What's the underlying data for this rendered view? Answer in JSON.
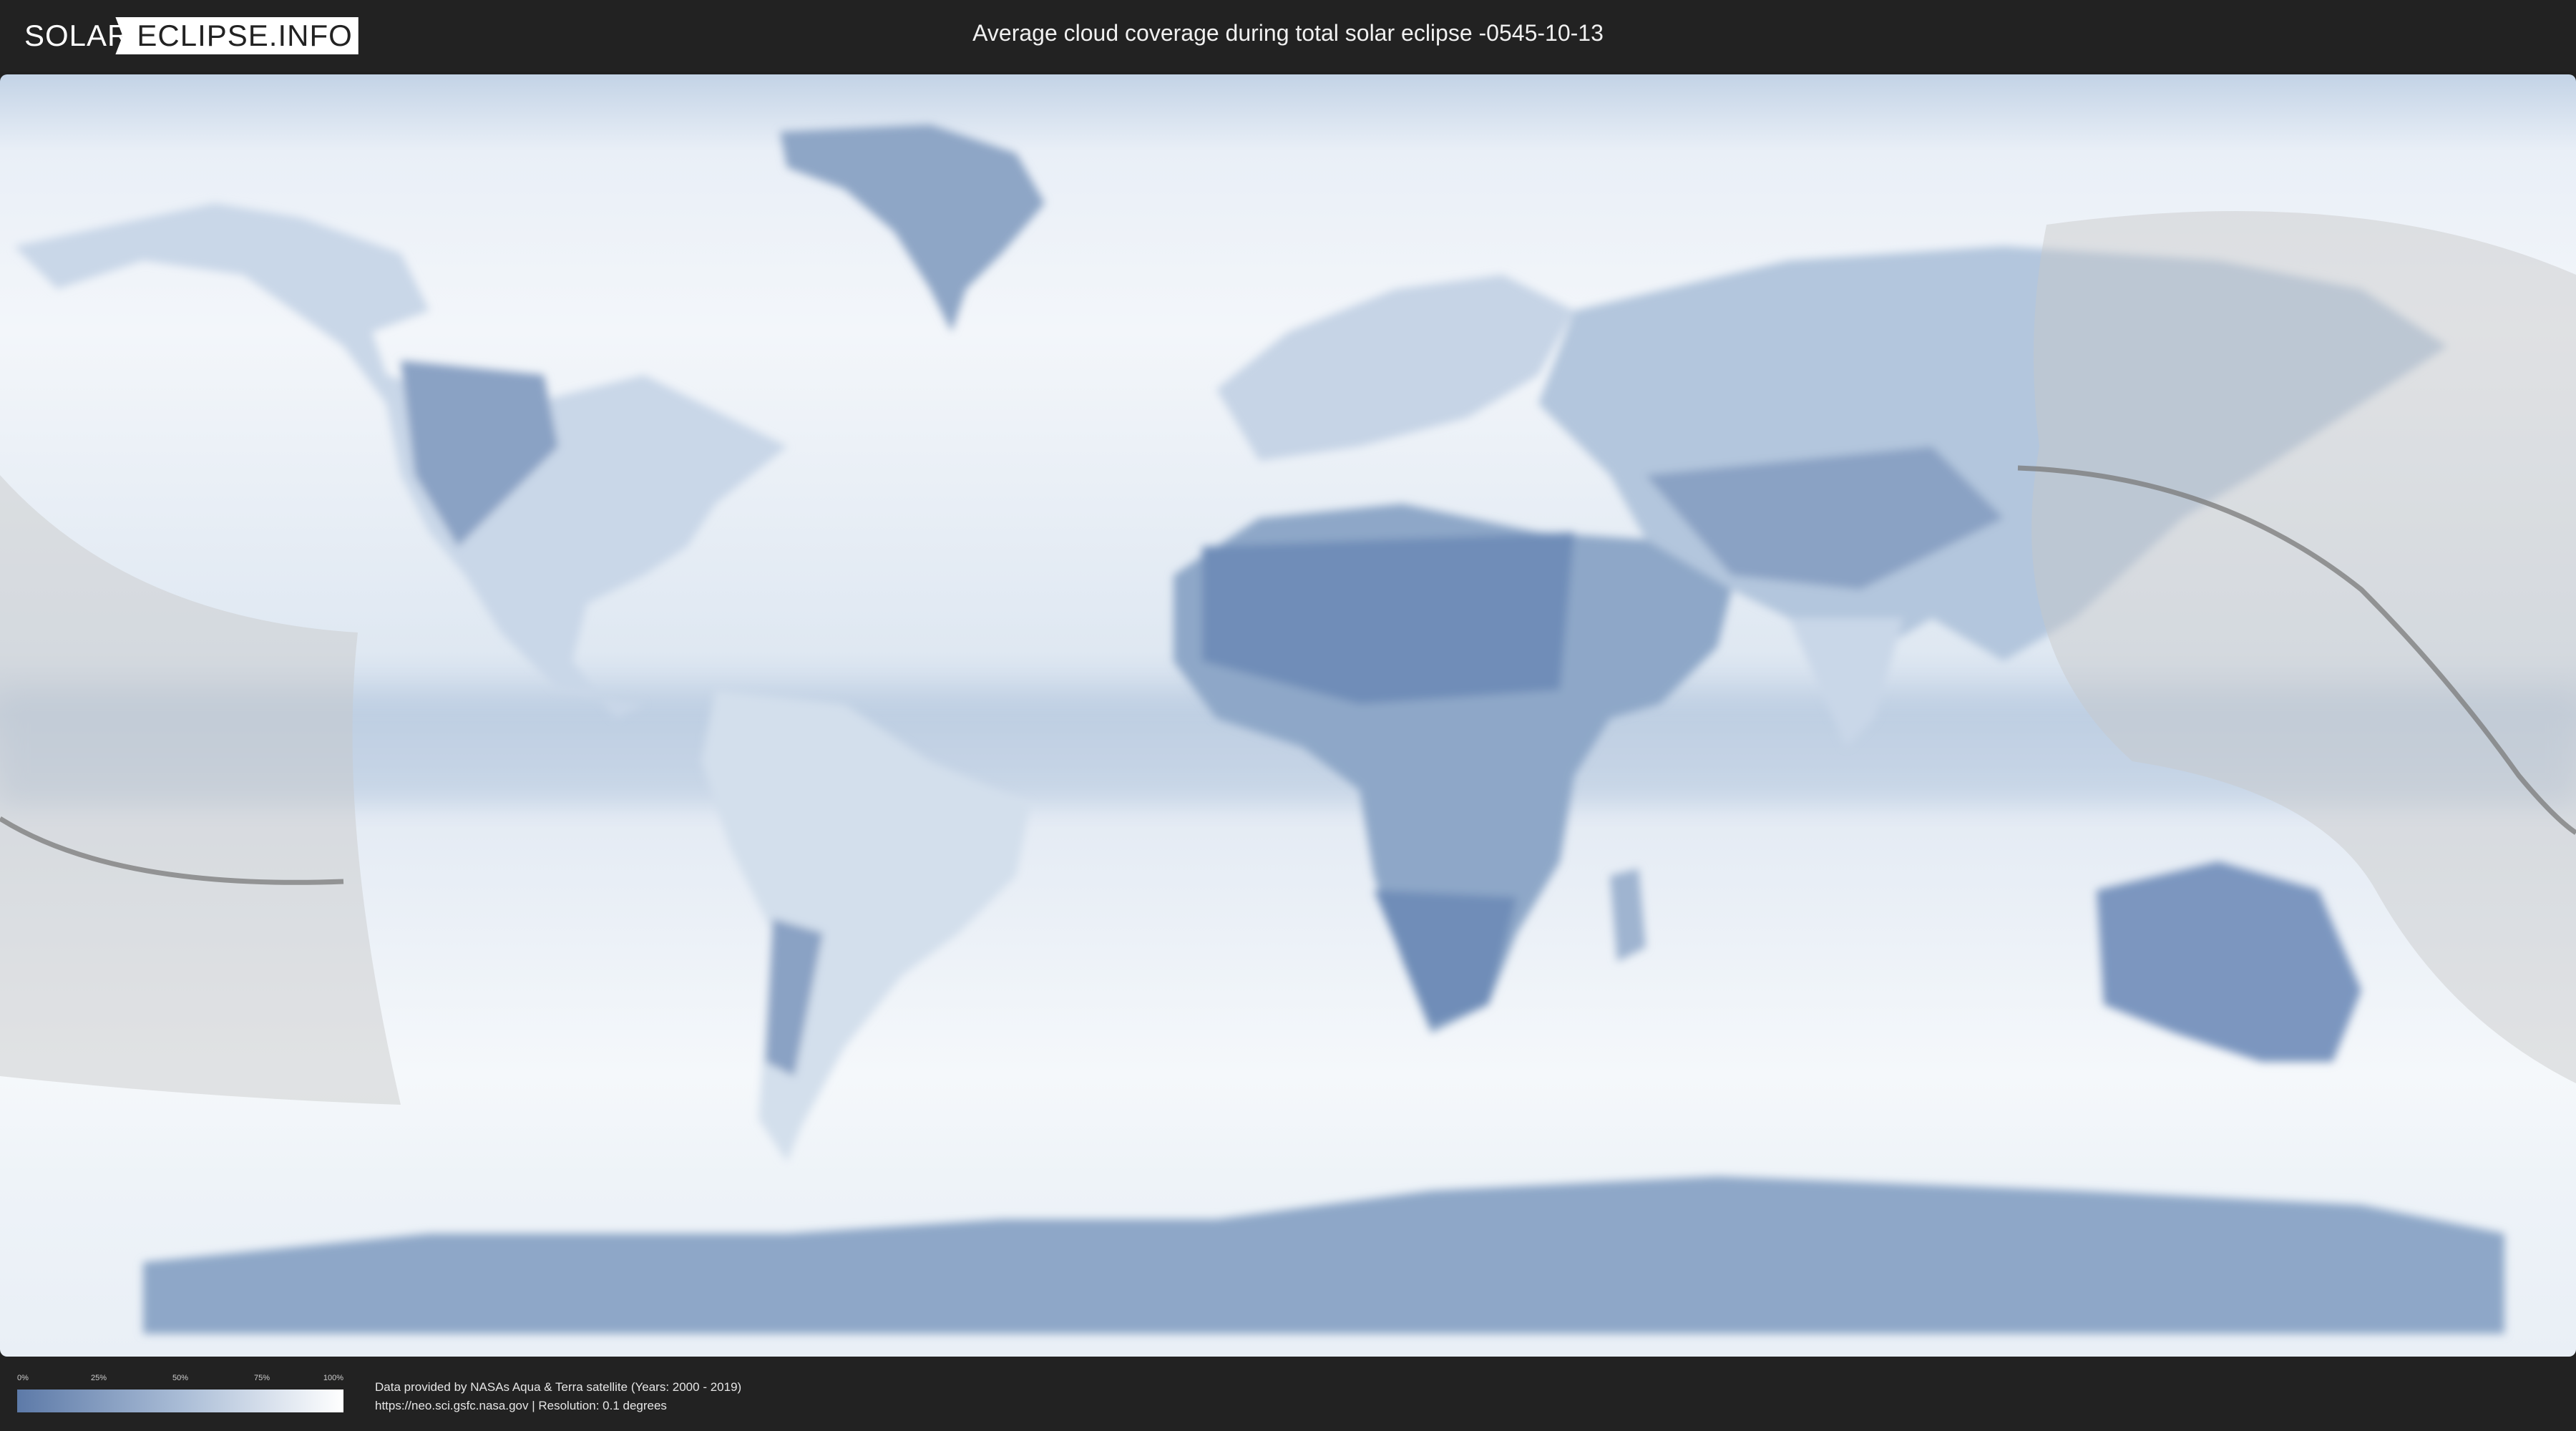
{
  "header": {
    "logo_left": "SOLAR",
    "logo_right": "ECLIPSE.INFO",
    "title": "Average cloud coverage during total solar eclipse -0545-10-13"
  },
  "legend": {
    "ticks": [
      "0%",
      "25%",
      "50%",
      "75%",
      "100%"
    ],
    "color_low": "#5d7aa8",
    "color_high": "#ffffff"
  },
  "credits": {
    "line1": "Data provided by NASAs Aqua & Terra satellite (Years: 2000 - 2019)",
    "line2": "https://neo.sci.gsfc.nasa.gov | Resolution: 0.1 degrees"
  },
  "colors": {
    "clear_sky": "#6f8db8",
    "cloudy": "#f4f7fb",
    "eclipse_zone": "#c8c8c8",
    "central_line": "#7a7a7a"
  }
}
